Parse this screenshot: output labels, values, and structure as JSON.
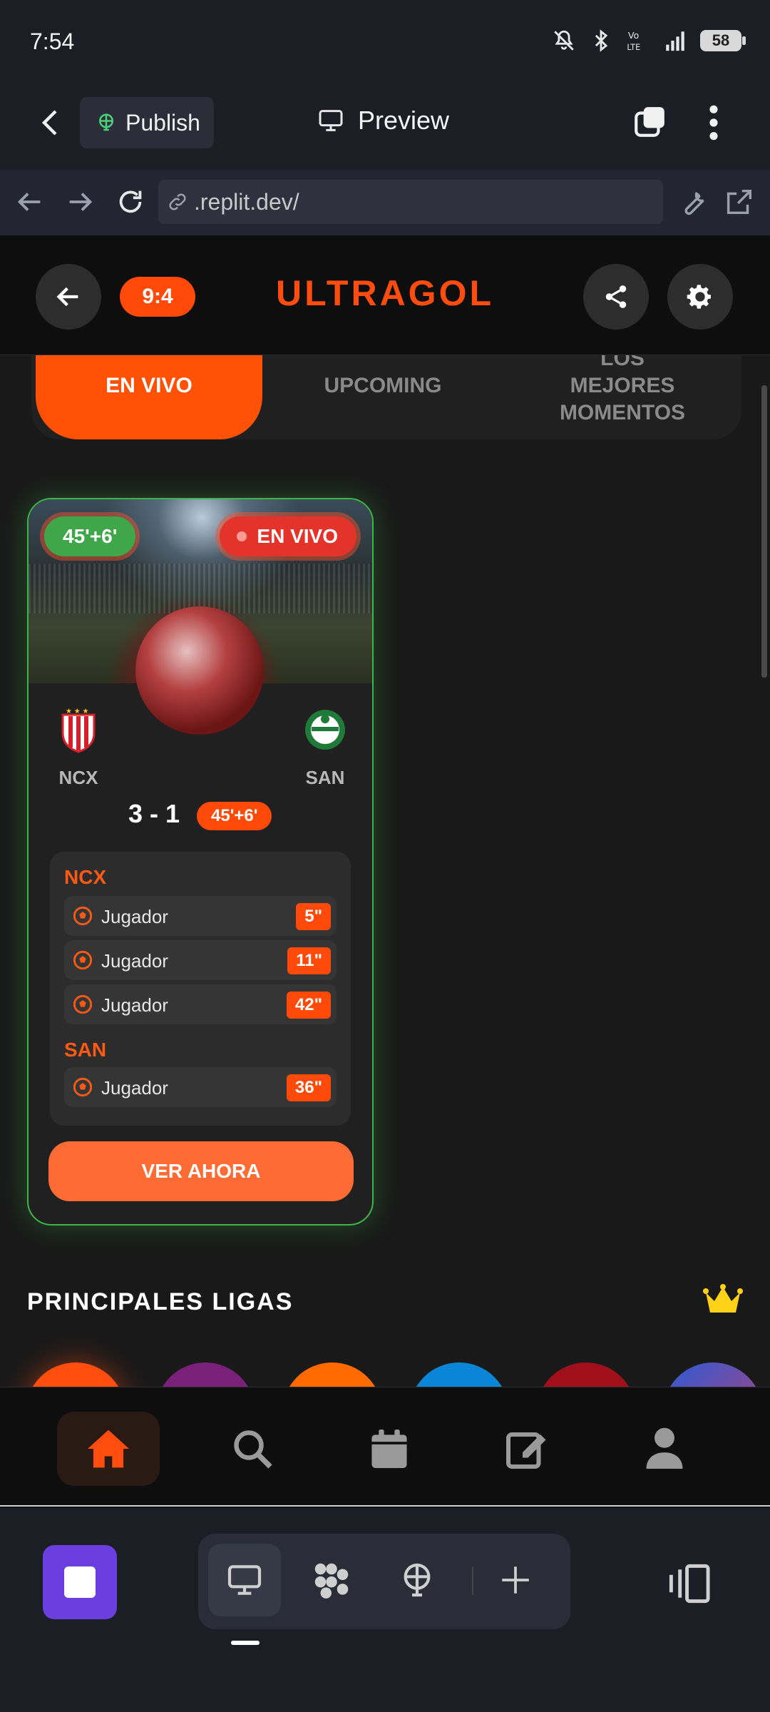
{
  "status_bar": {
    "time": "7:54",
    "battery": "58"
  },
  "replit_header": {
    "publish_label": "Publish",
    "preview_label": "Preview"
  },
  "url_bar": {
    "url": ".replit.dev/"
  },
  "app_header": {
    "badge": "9:4",
    "brand": "ULTRAGOL"
  },
  "tabs": [
    {
      "label": "EN VIVO",
      "active": true
    },
    {
      "label": "UPCOMING",
      "active": false
    },
    {
      "label": "LOS\nMEJORES\nMOMENTOS",
      "active": false
    }
  ],
  "match": {
    "time_badge": "45'+6'",
    "live_badge": "EN VIVO",
    "home": {
      "code": "NCX"
    },
    "away": {
      "code": "SAN"
    },
    "score": "3 - 1",
    "minute": "45'+6'",
    "events": [
      {
        "team": "NCX",
        "goals": [
          {
            "player": "Jugador",
            "minute": "5\""
          },
          {
            "player": "Jugador",
            "minute": "11\""
          },
          {
            "player": "Jugador",
            "minute": "42\""
          }
        ]
      },
      {
        "team": "SAN",
        "goals": [
          {
            "player": "Jugador",
            "minute": "36\""
          }
        ]
      }
    ],
    "watch_label": "VER AHORA"
  },
  "ligas": {
    "title": "PRINCIPALES LIGAS"
  },
  "colors": {
    "accent": "#ff4d10",
    "live_green": "#3fb44a",
    "replit_purple": "#6b3ee0"
  }
}
